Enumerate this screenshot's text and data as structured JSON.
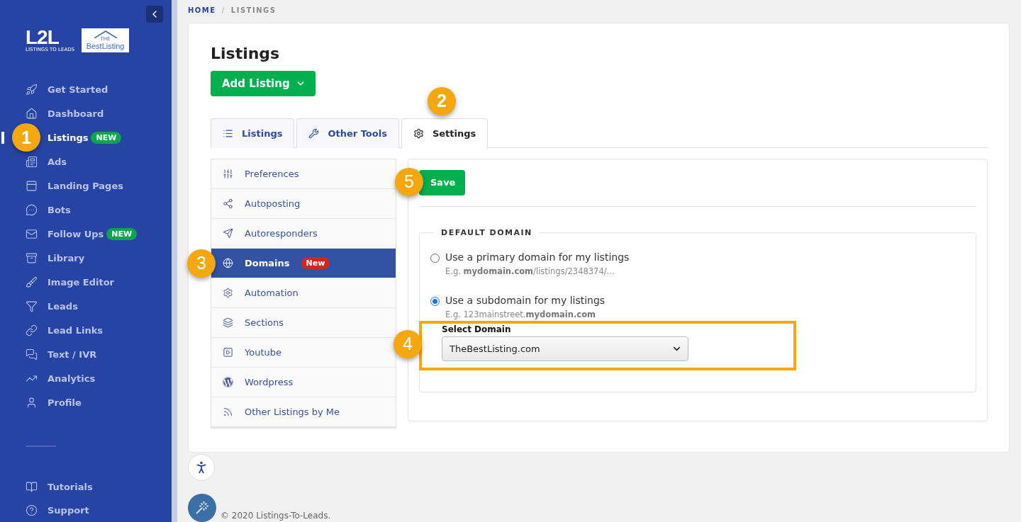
{
  "sidebar": {
    "logo": {
      "mark": "L2L",
      "tagline": "LISTINGS TO LEADS",
      "partner_small": "THE",
      "partner": "BestListing"
    },
    "items": [
      {
        "label": "Get Started",
        "selected": false
      },
      {
        "label": "Dashboard",
        "selected": false
      },
      {
        "label": "Listings",
        "badge": "NEW",
        "selected": true
      },
      {
        "label": "Ads",
        "selected": false
      },
      {
        "label": "Landing Pages",
        "selected": false
      },
      {
        "label": "Bots",
        "selected": false
      },
      {
        "label": "Follow Ups",
        "badge": "NEW",
        "selected": false
      },
      {
        "label": "Library",
        "selected": false
      },
      {
        "label": "Image Editor",
        "selected": false
      },
      {
        "label": "Leads",
        "selected": false
      },
      {
        "label": "Lead Links",
        "selected": false
      },
      {
        "label": "Text / IVR",
        "selected": false
      },
      {
        "label": "Analytics",
        "selected": false
      },
      {
        "label": "Profile",
        "selected": false
      }
    ],
    "bottom_items": [
      {
        "label": "Tutorials"
      },
      {
        "label": "Support"
      }
    ]
  },
  "breadcrumb": [
    "HOME",
    "LISTINGS"
  ],
  "breadcrumb_separator": "/",
  "page_title": "Listings",
  "add_button": "Add Listing",
  "tabs": [
    {
      "label": "Listings",
      "selected": false
    },
    {
      "label": "Other Tools",
      "selected": false
    },
    {
      "label": "Settings",
      "selected": true
    }
  ],
  "settings_menu": [
    {
      "label": "Preferences",
      "selected": false
    },
    {
      "label": "Autoposting",
      "selected": false
    },
    {
      "label": "Autoresponders",
      "selected": false
    },
    {
      "label": "Domains",
      "badge": "New",
      "selected": true
    },
    {
      "label": "Automation",
      "selected": false
    },
    {
      "label": "Sections",
      "selected": false
    },
    {
      "label": "Youtube",
      "selected": false
    },
    {
      "label": "Wordpress",
      "selected": false
    },
    {
      "label": "Other Listings by Me",
      "selected": false
    }
  ],
  "save_button": "Save",
  "default_domain": {
    "legend": "DEFAULT DOMAIN",
    "options": [
      {
        "label": "Use a primary domain for my listings",
        "hint": "E.g. **mydomain.com**/listings/2348374/...",
        "selected": false
      },
      {
        "label": "Use a subdomain for my listings",
        "hint": "E.g. 123mainstreet.**mydomain.com**",
        "selected": true
      }
    ],
    "select": {
      "label": "Select Domain",
      "value": "TheBestListing.com"
    }
  },
  "callouts": [
    "1",
    "2",
    "3",
    "4",
    "5"
  ],
  "footer": "© 2020 Listings-To-Leads."
}
